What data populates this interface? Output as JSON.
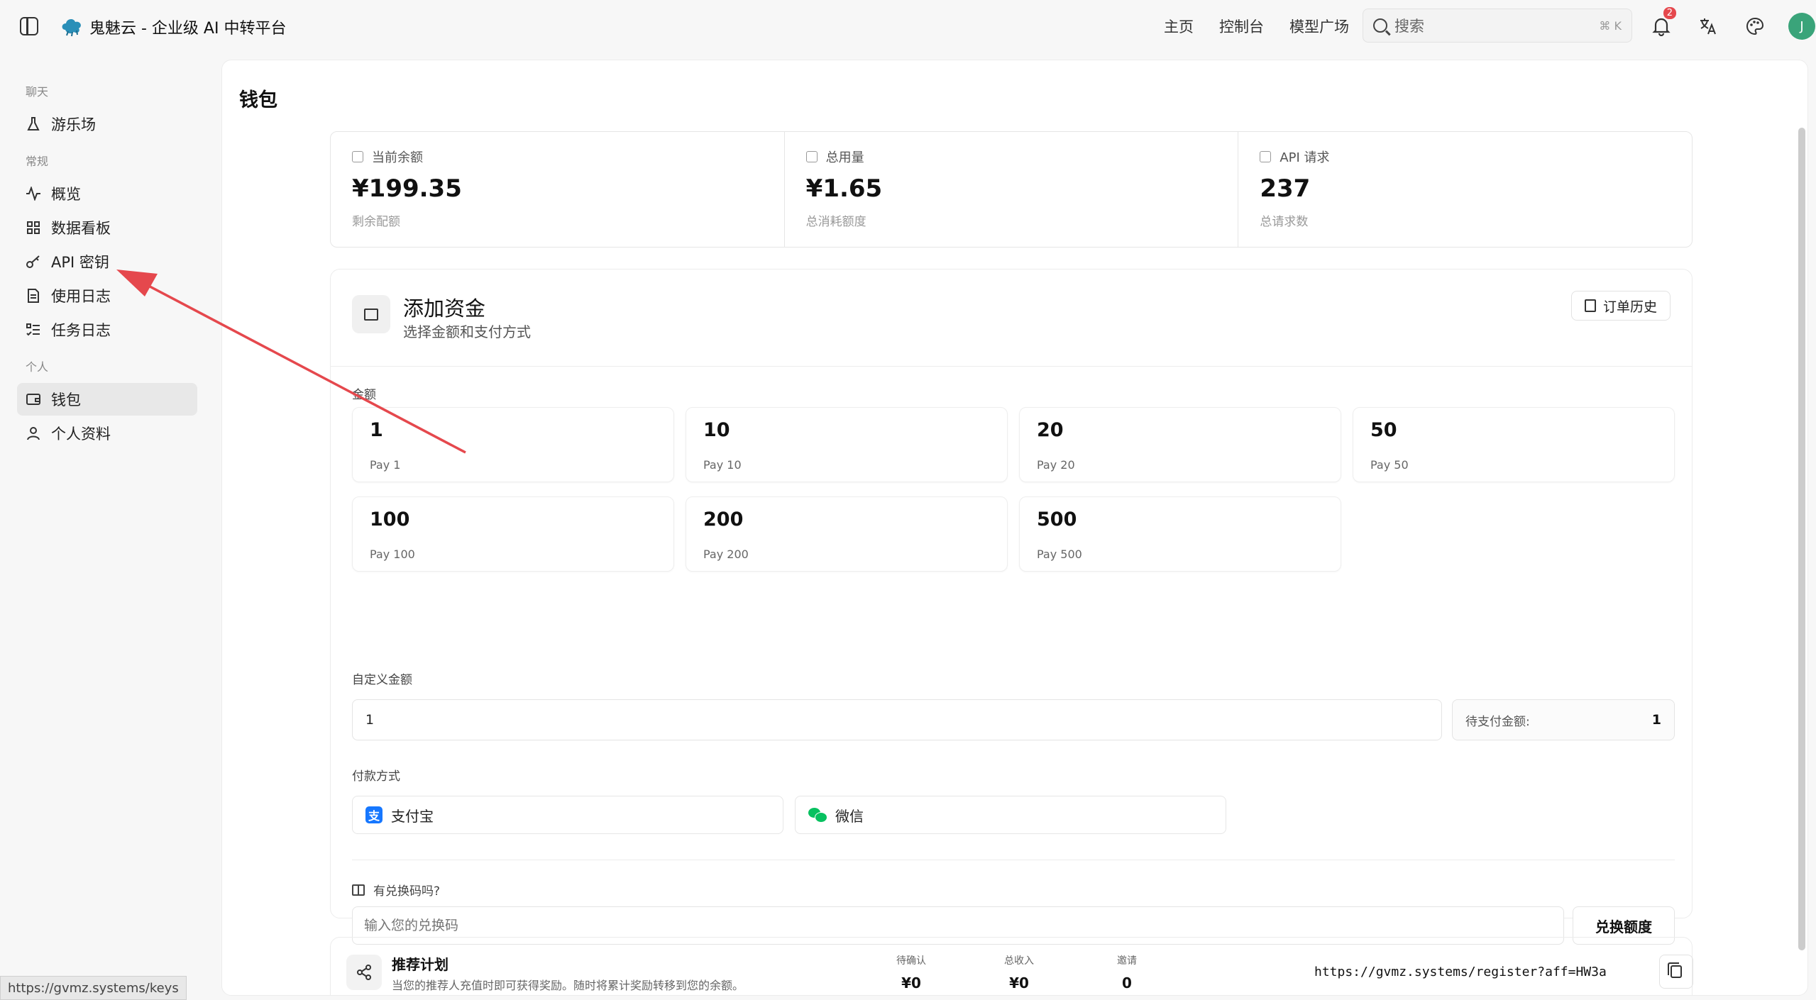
{
  "app": {
    "title": "鬼魅云 - 企业级 AI 中转平台"
  },
  "nav": {
    "home": "主页",
    "console": "控制台",
    "models": "模型广场"
  },
  "search": {
    "placeholder": "搜索",
    "shortcut": "⌘ K"
  },
  "notifications": {
    "count": "2"
  },
  "user": {
    "avatar_initial": "J"
  },
  "sidebar": {
    "sections": {
      "chat": "聊天",
      "general": "常规",
      "personal": "个人"
    },
    "items": [
      {
        "label": "游乐场",
        "icon": "flask-icon"
      },
      {
        "label": "概览",
        "icon": "activity-icon"
      },
      {
        "label": "数据看板",
        "icon": "grid-icon"
      },
      {
        "label": "API 密钥",
        "icon": "key-icon"
      },
      {
        "label": "使用日志",
        "icon": "document-icon"
      },
      {
        "label": "任务日志",
        "icon": "list-check-icon"
      },
      {
        "label": "钱包",
        "icon": "wallet-icon"
      },
      {
        "label": "个人资料",
        "icon": "user-icon"
      }
    ]
  },
  "page": {
    "title": "钱包"
  },
  "stats": [
    {
      "label": "当前余额",
      "value": "¥199.35",
      "sub": "剩余配额"
    },
    {
      "label": "总用量",
      "value": "¥1.65",
      "sub": "总消耗额度"
    },
    {
      "label": "API 请求",
      "value": "237",
      "sub": "总请求数"
    }
  ],
  "add_funds": {
    "title": "添加资金",
    "subtitle": "选择金额和支付方式",
    "order_history": "订单历史",
    "amount_label": "金额",
    "amounts": [
      {
        "value": "1",
        "desc": "Pay 1"
      },
      {
        "value": "10",
        "desc": "Pay 10"
      },
      {
        "value": "20",
        "desc": "Pay 20"
      },
      {
        "value": "50",
        "desc": "Pay 50"
      },
      {
        "value": "100",
        "desc": "Pay 100"
      },
      {
        "value": "200",
        "desc": "Pay 200"
      },
      {
        "value": "500",
        "desc": "Pay 500"
      }
    ],
    "custom_label": "自定义金额",
    "custom_value": "1",
    "pending_label": "待支付金额:",
    "pending_value": "1",
    "payment_label": "付款方式",
    "payment_methods": [
      {
        "label": "支付宝",
        "icon": "alipay-icon",
        "mark": "支"
      },
      {
        "label": "微信",
        "icon": "wechat-icon"
      }
    ],
    "redeem_label": "有兑换码吗?",
    "redeem_placeholder": "输入您的兑换码",
    "redeem_button": "兑换额度"
  },
  "referral": {
    "title": "推荐计划",
    "desc": "当您的推荐人充值时即可获得奖励。随时将累计奖励转移到您的余额。",
    "stats": [
      {
        "label": "待确认",
        "value": "¥0"
      },
      {
        "label": "总收入",
        "value": "¥0"
      },
      {
        "label": "邀请",
        "value": "0"
      }
    ],
    "link": "https://gvmz.systems/register?aff=HW3a"
  },
  "status_bar": {
    "url": "https://gvmz.systems/keys"
  },
  "colors": {
    "annotation_arrow": "#e5484d",
    "avatar": "#3aa47a",
    "alipay": "#1677ff",
    "wechat": "#07c160"
  }
}
